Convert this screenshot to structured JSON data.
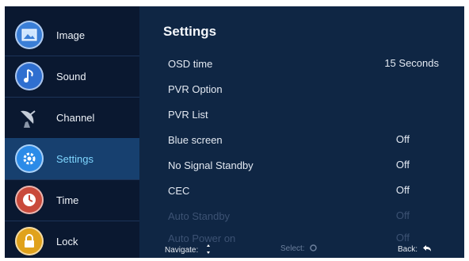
{
  "sidebar": {
    "items": [
      {
        "label": "Image",
        "icon": "image-icon",
        "color": "#3a7ed6"
      },
      {
        "label": "Sound",
        "icon": "music-note-icon",
        "color": "#2f6fd0"
      },
      {
        "label": "Channel",
        "icon": "satellite-dish-icon",
        "color": "#6a7e96"
      },
      {
        "label": "Settings",
        "icon": "gear-icon",
        "color": "#2b8be8"
      },
      {
        "label": "Time",
        "icon": "clock-icon",
        "color": "#c94a3b"
      },
      {
        "label": "Lock",
        "icon": "padlock-icon",
        "color": "#e0a21c"
      }
    ],
    "active_index": 3
  },
  "settings": {
    "title": "Settings",
    "rows": [
      {
        "label": "OSD time",
        "value": "15 Seconds",
        "enabled": true
      },
      {
        "label": "PVR Option",
        "value": "",
        "enabled": true
      },
      {
        "label": "PVR List",
        "value": "",
        "enabled": true
      },
      {
        "label": "Blue screen",
        "value": "Off",
        "enabled": true
      },
      {
        "label": "No Signal Standby",
        "value": "Off",
        "enabled": true
      },
      {
        "label": "CEC",
        "value": "Off",
        "enabled": true
      },
      {
        "label": "Auto Standby",
        "value": "Off",
        "enabled": false
      },
      {
        "label": "Auto Power on",
        "value": "Off",
        "enabled": false
      }
    ]
  },
  "footer": {
    "navigate_label": "Navigate:",
    "select_label": "Select:",
    "back_label": "Back:"
  }
}
